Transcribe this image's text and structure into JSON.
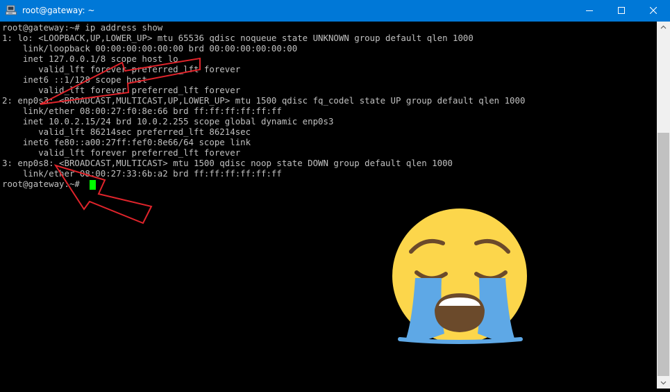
{
  "window": {
    "title": "root@gateway: ~",
    "titlebar_color": "#0078d7",
    "controls": [
      "minimize-icon",
      "maximize-icon",
      "close-icon"
    ]
  },
  "terminal": {
    "lines": [
      "root@gateway:~# ip address show",
      "1: lo: <LOOPBACK,UP,LOWER_UP> mtu 65536 qdisc noqueue state UNKNOWN group default qlen 1000",
      "    link/loopback 00:00:00:00:00:00 brd 00:00:00:00:00:00",
      "    inet 127.0.0.1/8 scope host lo",
      "       valid_lft forever preferred_lft forever",
      "    inet6 ::1/128 scope host",
      "       valid_lft forever preferred_lft forever",
      "2: enp0s3: <BROADCAST,MULTICAST,UP,LOWER_UP> mtu 1500 qdisc fq_codel state UP group default qlen 1000",
      "    link/ether 08:00:27:f0:8e:66 brd ff:ff:ff:ff:ff:ff",
      "    inet 10.0.2.15/24 brd 10.0.2.255 scope global dynamic enp0s3",
      "       valid_lft 86214sec preferred_lft 86214sec",
      "    inet6 fe80::a00:27ff:fef0:8e66/64 scope link",
      "       valid_lft forever preferred_lft forever",
      "3: enp0s8: <BROADCAST,MULTICAST> mtu 1500 qdisc noop state DOWN group default qlen 1000",
      "    link/ether 08:00:27:33:6b:a2 brd ff:ff:ff:ff:ff:ff",
      "root@gateway:~# "
    ],
    "text_color": "#c0c0c0",
    "cursor_color": "#00ff00"
  },
  "annotations": {
    "arrow_color": "#e0242b",
    "emoji": "loudly-crying-face-icon"
  }
}
